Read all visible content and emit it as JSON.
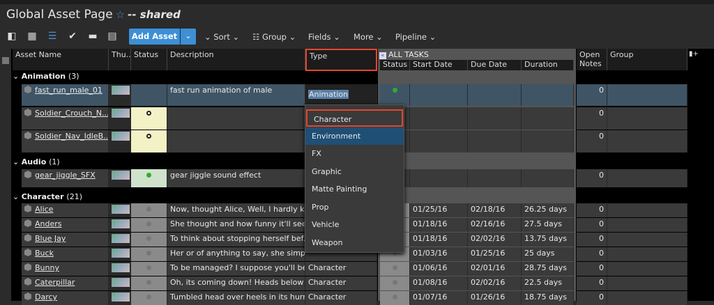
{
  "title": {
    "name": "Global Asset Page",
    "shared": "-- shared"
  },
  "toolbar": {
    "add_asset": "Add Asset",
    "sort": "Sort",
    "group": "Group",
    "fields": "Fields",
    "more": "More",
    "pipeline": "Pipeline"
  },
  "columns": {
    "asset_name": "Asset Name",
    "thumb": "Thu...",
    "status": "Status",
    "description": "Description",
    "type": "Type",
    "all_tasks": "ALL TASKS",
    "task_status": "Status",
    "start_date": "Start Date",
    "due_date": "Due Date",
    "duration": "Duration",
    "open_notes": "Open Notes",
    "group": "Group"
  },
  "groups": [
    {
      "name": "Animation",
      "count": "(3)",
      "rows": [
        {
          "name": "fast_run_male_01",
          "desc": "fast run animation of male",
          "type": "Animation",
          "notes": "0",
          "selected": true
        },
        {
          "name": "Soldier_Crouch_N...",
          "desc": "",
          "type": "",
          "notes": "0"
        },
        {
          "name": "Soldier_Nav_IdleB...",
          "desc": "",
          "type": "",
          "notes": "0"
        }
      ]
    },
    {
      "name": "Audio",
      "count": "(1)",
      "rows": [
        {
          "name": "gear_jiggle_SFX",
          "desc": "gear jiggle sound effect",
          "type": "",
          "notes": "0"
        }
      ]
    },
    {
      "name": "Character",
      "count": "(21)",
      "rows": [
        {
          "name": "Alice",
          "desc": "Now, thought Alice, Well, I hardly k...",
          "type": "",
          "start": "01/25/16",
          "due": "02/18/16",
          "duration": "26.25 days",
          "notes": "0"
        },
        {
          "name": "Anders",
          "desc": "She thought and how funny it'll see...",
          "type": "",
          "start": "01/18/16",
          "due": "02/16/16",
          "duration": "27.5 days",
          "notes": "0"
        },
        {
          "name": "Blue Jay",
          "desc": "To think about stopping herself bef...",
          "type": "",
          "start": "01/18/16",
          "due": "02/02/16",
          "duration": "13.75 days",
          "notes": "0"
        },
        {
          "name": "Buck",
          "desc": "Her or of anything to say, she simpl...",
          "type": "",
          "start": "01/03/16",
          "due": "01/25/16",
          "duration": "25 days",
          "notes": "0"
        },
        {
          "name": "Bunny",
          "desc": "To be managed? I suppose you'll be...",
          "type": "Character",
          "start": "01/06/16",
          "due": "02/01/16",
          "duration": "28.75 days",
          "notes": "0"
        },
        {
          "name": "Caterpillar",
          "desc": "Oh, its coming down! Heads below! ...",
          "type": "Character",
          "start": "01/08/16",
          "due": "02/02/16",
          "duration": "22.5 days",
          "notes": "0"
        },
        {
          "name": "Darcy",
          "desc": "Tumbled head over heels in its hurr...",
          "type": "Character",
          "start": "01/07/16",
          "due": "01/26/16",
          "duration": "18.75 days",
          "notes": "0"
        }
      ]
    }
  ],
  "dropdown": {
    "items": [
      "Character",
      "Environment",
      "FX",
      "Graphic",
      "Matte Painting",
      "Prop",
      "Vehicle",
      "Weapon"
    ],
    "highlighted": "Environment",
    "outlined": "Character"
  },
  "colors": {
    "accent": "#3d8fd6",
    "highlight": "#e8452c",
    "selected_row": "#3f5566"
  }
}
